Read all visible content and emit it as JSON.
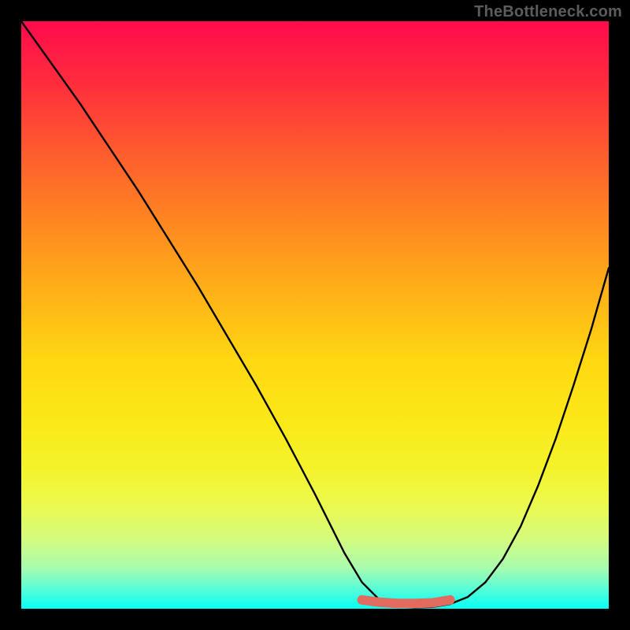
{
  "watermark": "TheBottleneck.com",
  "colors": {
    "frame": "#000000",
    "curve": "#000000",
    "accent": "#e16b5e",
    "gradient_stops": [
      {
        "pos": 0.0,
        "hex": "#ff0b4c"
      },
      {
        "pos": 0.1,
        "hex": "#ff2b3e"
      },
      {
        "pos": 0.22,
        "hex": "#ff5a2e"
      },
      {
        "pos": 0.35,
        "hex": "#ff8a20"
      },
      {
        "pos": 0.48,
        "hex": "#ffb716"
      },
      {
        "pos": 0.58,
        "hex": "#ffd812"
      },
      {
        "pos": 0.68,
        "hex": "#fbe818"
      },
      {
        "pos": 0.76,
        "hex": "#f4f32a"
      },
      {
        "pos": 0.82,
        "hex": "#edf94b"
      },
      {
        "pos": 0.88,
        "hex": "#d5fb7d"
      },
      {
        "pos": 0.93,
        "hex": "#a9fcae"
      },
      {
        "pos": 0.97,
        "hex": "#4ffddb"
      },
      {
        "pos": 1.0,
        "hex": "#06fef3"
      }
    ]
  },
  "chart_data": {
    "type": "line",
    "title": "",
    "xlabel": "",
    "ylabel": "",
    "xlim": [
      0,
      100
    ],
    "ylim": [
      0,
      100
    ],
    "series": [
      {
        "name": "curve",
        "x": [
          0,
          5,
          10,
          15,
          20,
          25,
          30,
          35,
          40,
          45,
          50,
          55,
          58,
          61,
          64,
          67,
          70,
          73,
          76,
          79,
          82,
          85,
          88,
          91,
          94,
          97,
          100
        ],
        "values": [
          100,
          93,
          86,
          78.5,
          71,
          63,
          55,
          46.5,
          38,
          29,
          19.5,
          9.5,
          4.5,
          1.5,
          0.4,
          0.2,
          0.3,
          0.8,
          2.0,
          4.5,
          8.5,
          14,
          21,
          29,
          38,
          47.5,
          58
        ]
      },
      {
        "name": "accent-flat",
        "x": [
          58,
          61,
          64,
          67,
          70,
          73
        ],
        "values": [
          1.5,
          1.1,
          0.9,
          0.9,
          1.0,
          1.5
        ]
      }
    ]
  }
}
